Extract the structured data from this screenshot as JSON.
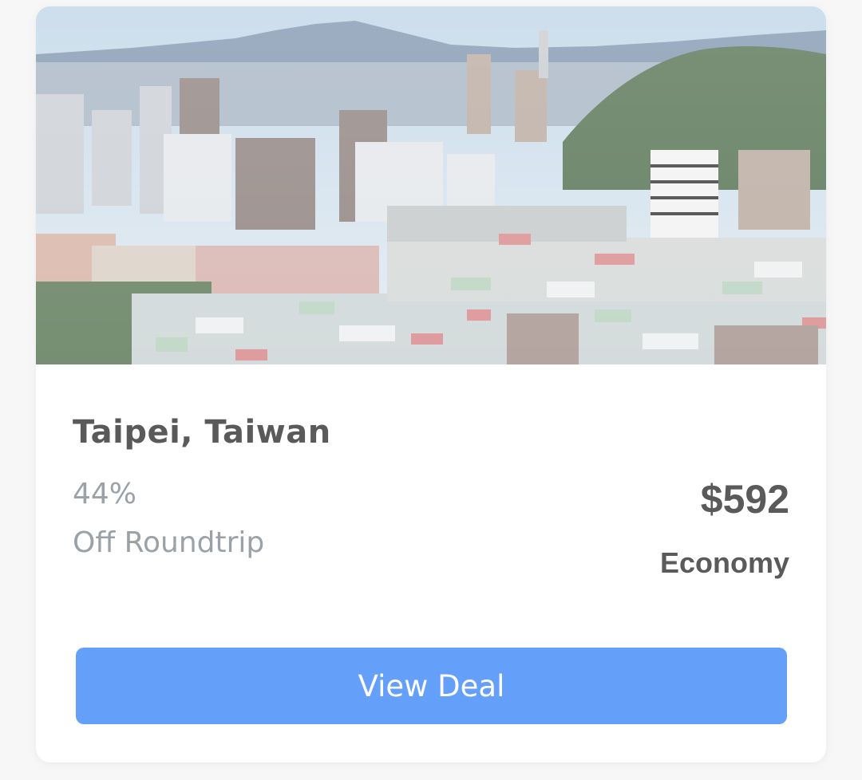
{
  "card": {
    "destination": "Taipei, Taiwan",
    "discount": "44%",
    "discount_note": "Off Roundtrip",
    "price": "$592",
    "cabin_class": "Economy",
    "cta_label": "View Deal"
  },
  "colors": {
    "button": "#649ffa",
    "title_text": "#5a5a5a",
    "muted_text": "#9aa1a7"
  }
}
